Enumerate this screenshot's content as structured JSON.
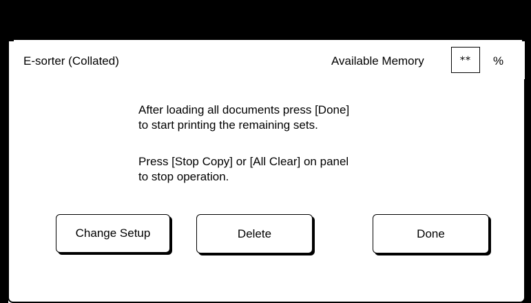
{
  "header": {
    "title": "E-sorter (Collated)",
    "memory_label": "Available Memory",
    "memory_value": "**",
    "memory_unit": "%"
  },
  "messages": {
    "line1": "After loading all documents press [Done]",
    "line2": "to start printing the remaining sets.",
    "line3": "Press [Stop Copy] or [All Clear] on panel",
    "line4": "to stop operation."
  },
  "buttons": {
    "change_setup": "Change Setup",
    "delete": "Delete",
    "done": "Done"
  },
  "colors": {
    "background": "#ffffff",
    "frame": "#000000"
  }
}
